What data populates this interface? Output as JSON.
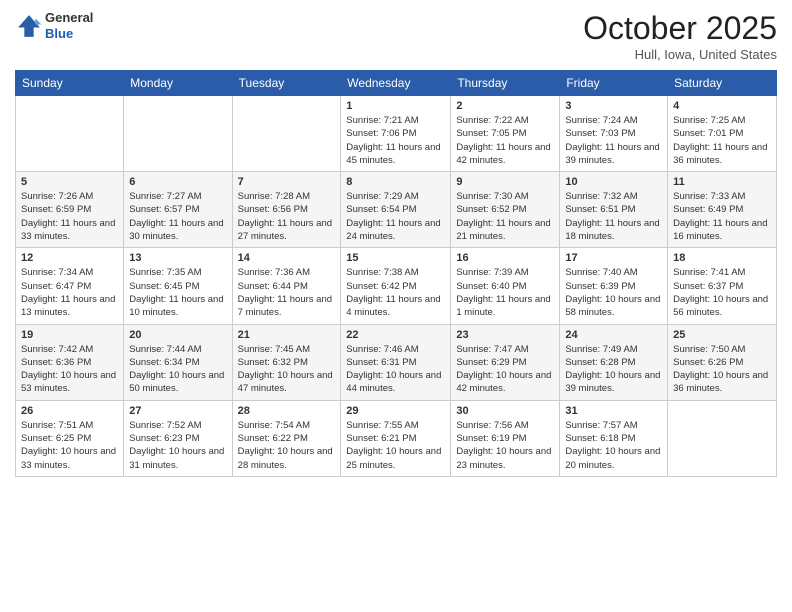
{
  "header": {
    "logo": {
      "line1": "General",
      "line2": "Blue"
    },
    "title": "October 2025",
    "location": "Hull, Iowa, United States"
  },
  "weekdays": [
    "Sunday",
    "Monday",
    "Tuesday",
    "Wednesday",
    "Thursday",
    "Friday",
    "Saturday"
  ],
  "weeks": [
    [
      {
        "day": "",
        "sunrise": "",
        "sunset": "",
        "daylight": ""
      },
      {
        "day": "",
        "sunrise": "",
        "sunset": "",
        "daylight": ""
      },
      {
        "day": "",
        "sunrise": "",
        "sunset": "",
        "daylight": ""
      },
      {
        "day": "1",
        "sunrise": "Sunrise: 7:21 AM",
        "sunset": "Sunset: 7:06 PM",
        "daylight": "Daylight: 11 hours and 45 minutes."
      },
      {
        "day": "2",
        "sunrise": "Sunrise: 7:22 AM",
        "sunset": "Sunset: 7:05 PM",
        "daylight": "Daylight: 11 hours and 42 minutes."
      },
      {
        "day": "3",
        "sunrise": "Sunrise: 7:24 AM",
        "sunset": "Sunset: 7:03 PM",
        "daylight": "Daylight: 11 hours and 39 minutes."
      },
      {
        "day": "4",
        "sunrise": "Sunrise: 7:25 AM",
        "sunset": "Sunset: 7:01 PM",
        "daylight": "Daylight: 11 hours and 36 minutes."
      }
    ],
    [
      {
        "day": "5",
        "sunrise": "Sunrise: 7:26 AM",
        "sunset": "Sunset: 6:59 PM",
        "daylight": "Daylight: 11 hours and 33 minutes."
      },
      {
        "day": "6",
        "sunrise": "Sunrise: 7:27 AM",
        "sunset": "Sunset: 6:57 PM",
        "daylight": "Daylight: 11 hours and 30 minutes."
      },
      {
        "day": "7",
        "sunrise": "Sunrise: 7:28 AM",
        "sunset": "Sunset: 6:56 PM",
        "daylight": "Daylight: 11 hours and 27 minutes."
      },
      {
        "day": "8",
        "sunrise": "Sunrise: 7:29 AM",
        "sunset": "Sunset: 6:54 PM",
        "daylight": "Daylight: 11 hours and 24 minutes."
      },
      {
        "day": "9",
        "sunrise": "Sunrise: 7:30 AM",
        "sunset": "Sunset: 6:52 PM",
        "daylight": "Daylight: 11 hours and 21 minutes."
      },
      {
        "day": "10",
        "sunrise": "Sunrise: 7:32 AM",
        "sunset": "Sunset: 6:51 PM",
        "daylight": "Daylight: 11 hours and 18 minutes."
      },
      {
        "day": "11",
        "sunrise": "Sunrise: 7:33 AM",
        "sunset": "Sunset: 6:49 PM",
        "daylight": "Daylight: 11 hours and 16 minutes."
      }
    ],
    [
      {
        "day": "12",
        "sunrise": "Sunrise: 7:34 AM",
        "sunset": "Sunset: 6:47 PM",
        "daylight": "Daylight: 11 hours and 13 minutes."
      },
      {
        "day": "13",
        "sunrise": "Sunrise: 7:35 AM",
        "sunset": "Sunset: 6:45 PM",
        "daylight": "Daylight: 11 hours and 10 minutes."
      },
      {
        "day": "14",
        "sunrise": "Sunrise: 7:36 AM",
        "sunset": "Sunset: 6:44 PM",
        "daylight": "Daylight: 11 hours and 7 minutes."
      },
      {
        "day": "15",
        "sunrise": "Sunrise: 7:38 AM",
        "sunset": "Sunset: 6:42 PM",
        "daylight": "Daylight: 11 hours and 4 minutes."
      },
      {
        "day": "16",
        "sunrise": "Sunrise: 7:39 AM",
        "sunset": "Sunset: 6:40 PM",
        "daylight": "Daylight: 11 hours and 1 minute."
      },
      {
        "day": "17",
        "sunrise": "Sunrise: 7:40 AM",
        "sunset": "Sunset: 6:39 PM",
        "daylight": "Daylight: 10 hours and 58 minutes."
      },
      {
        "day": "18",
        "sunrise": "Sunrise: 7:41 AM",
        "sunset": "Sunset: 6:37 PM",
        "daylight": "Daylight: 10 hours and 56 minutes."
      }
    ],
    [
      {
        "day": "19",
        "sunrise": "Sunrise: 7:42 AM",
        "sunset": "Sunset: 6:36 PM",
        "daylight": "Daylight: 10 hours and 53 minutes."
      },
      {
        "day": "20",
        "sunrise": "Sunrise: 7:44 AM",
        "sunset": "Sunset: 6:34 PM",
        "daylight": "Daylight: 10 hours and 50 minutes."
      },
      {
        "day": "21",
        "sunrise": "Sunrise: 7:45 AM",
        "sunset": "Sunset: 6:32 PM",
        "daylight": "Daylight: 10 hours and 47 minutes."
      },
      {
        "day": "22",
        "sunrise": "Sunrise: 7:46 AM",
        "sunset": "Sunset: 6:31 PM",
        "daylight": "Daylight: 10 hours and 44 minutes."
      },
      {
        "day": "23",
        "sunrise": "Sunrise: 7:47 AM",
        "sunset": "Sunset: 6:29 PM",
        "daylight": "Daylight: 10 hours and 42 minutes."
      },
      {
        "day": "24",
        "sunrise": "Sunrise: 7:49 AM",
        "sunset": "Sunset: 6:28 PM",
        "daylight": "Daylight: 10 hours and 39 minutes."
      },
      {
        "day": "25",
        "sunrise": "Sunrise: 7:50 AM",
        "sunset": "Sunset: 6:26 PM",
        "daylight": "Daylight: 10 hours and 36 minutes."
      }
    ],
    [
      {
        "day": "26",
        "sunrise": "Sunrise: 7:51 AM",
        "sunset": "Sunset: 6:25 PM",
        "daylight": "Daylight: 10 hours and 33 minutes."
      },
      {
        "day": "27",
        "sunrise": "Sunrise: 7:52 AM",
        "sunset": "Sunset: 6:23 PM",
        "daylight": "Daylight: 10 hours and 31 minutes."
      },
      {
        "day": "28",
        "sunrise": "Sunrise: 7:54 AM",
        "sunset": "Sunset: 6:22 PM",
        "daylight": "Daylight: 10 hours and 28 minutes."
      },
      {
        "day": "29",
        "sunrise": "Sunrise: 7:55 AM",
        "sunset": "Sunset: 6:21 PM",
        "daylight": "Daylight: 10 hours and 25 minutes."
      },
      {
        "day": "30",
        "sunrise": "Sunrise: 7:56 AM",
        "sunset": "Sunset: 6:19 PM",
        "daylight": "Daylight: 10 hours and 23 minutes."
      },
      {
        "day": "31",
        "sunrise": "Sunrise: 7:57 AM",
        "sunset": "Sunset: 6:18 PM",
        "daylight": "Daylight: 10 hours and 20 minutes."
      },
      {
        "day": "",
        "sunrise": "",
        "sunset": "",
        "daylight": ""
      }
    ]
  ]
}
